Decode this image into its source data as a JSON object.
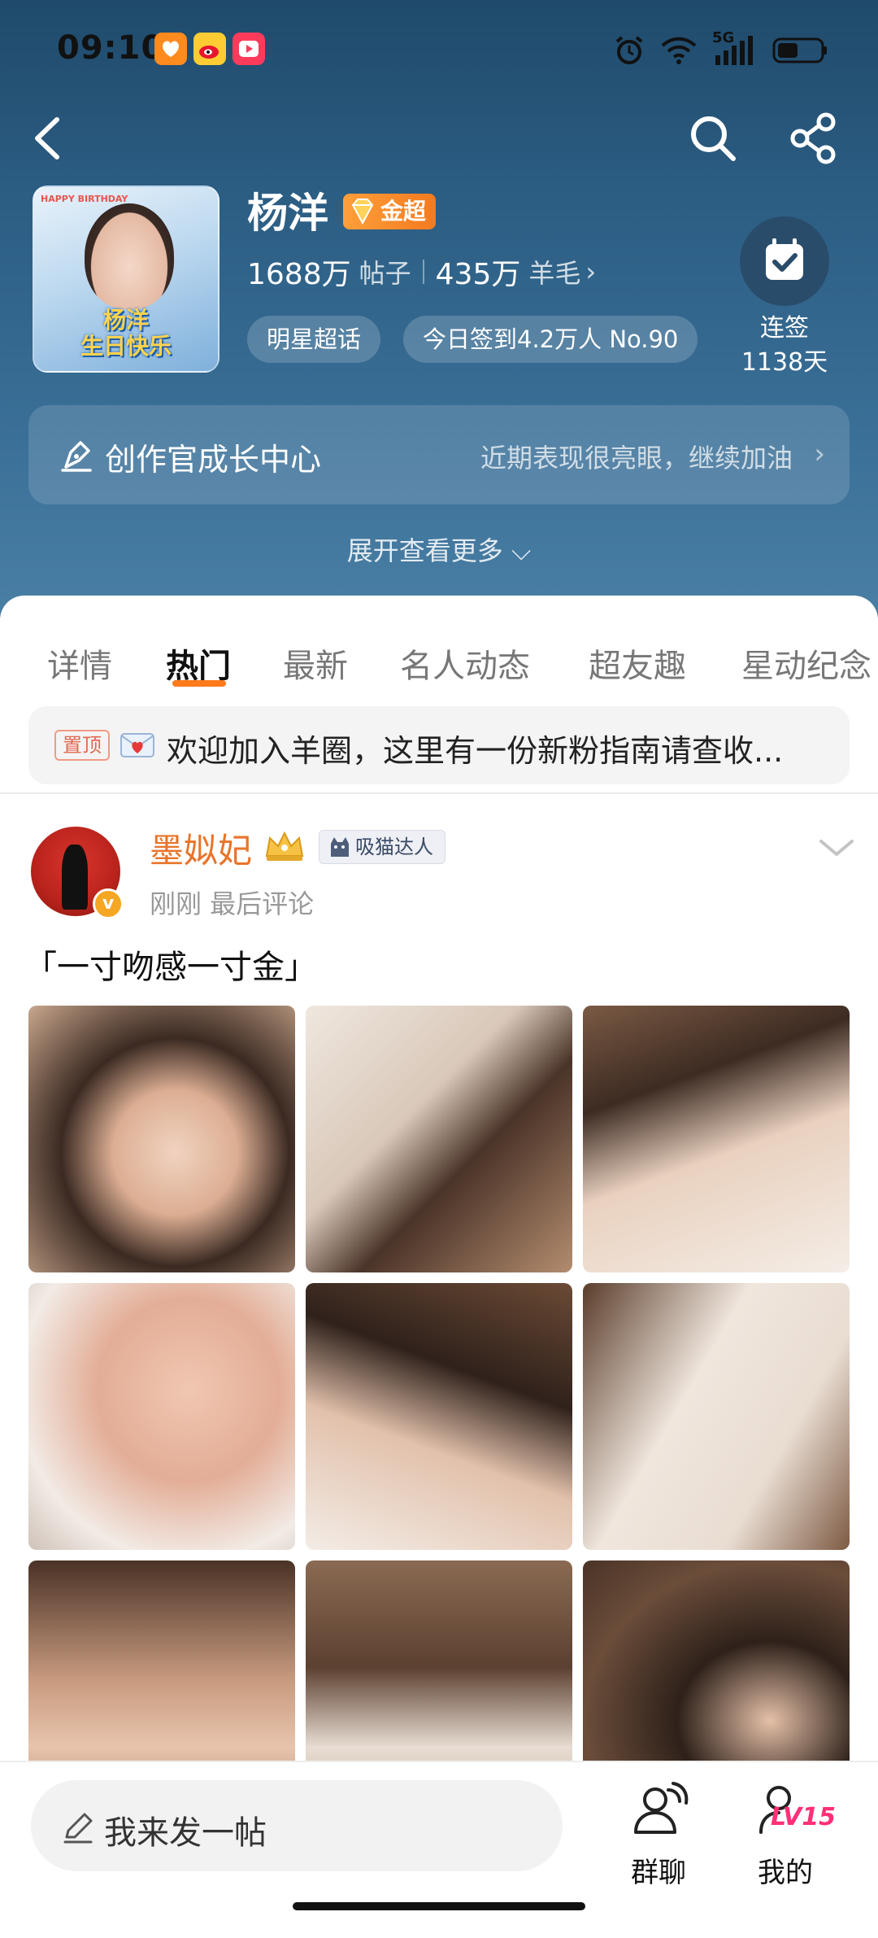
{
  "status_bar": {
    "time": "09:10",
    "network": "5G",
    "apps": [
      "taobao-icon",
      "weibo-icon",
      "video-icon"
    ],
    "system_icons": [
      "alarm-icon",
      "wifi-icon",
      "signal-icon",
      "battery-icon"
    ]
  },
  "header": {
    "back_icon": "chevron-left-icon",
    "search_icon": "search-icon",
    "share_icon": "share-icon"
  },
  "topic": {
    "name": "杨洋",
    "badge_label": "金超",
    "avatar_text": "杨洋\n生日快乐",
    "avatar_tag": "HAPPY BIRTHDAY",
    "posts_count": "1688万",
    "posts_unit": "帖子",
    "fans_count": "435万",
    "fans_unit": "羊毛",
    "fans_chevron": "›",
    "category_pill": "明星超话",
    "checkin_pill": "今日签到4.2万人 No.90",
    "streak_label": "连签",
    "streak_days": "1138天"
  },
  "creator_center": {
    "title": "创作官成长中心",
    "subtitle": "近期表现很亮眼，继续加油",
    "chevron": "›"
  },
  "expand_label": "展开查看更多 ⌵",
  "tabs": [
    {
      "label": "详情",
      "active": false
    },
    {
      "label": "热门",
      "active": true
    },
    {
      "label": "最新",
      "active": false
    },
    {
      "label": "名人动态",
      "active": false
    },
    {
      "label": "超友趣",
      "active": false
    },
    {
      "label": "星动纪念",
      "active": false
    }
  ],
  "pinned": {
    "tag": "置顶",
    "text": "欢迎加入羊圈，这里有一份新粉指南请查收..."
  },
  "post": {
    "author": "墨姒妃",
    "badge": "吸猫达人",
    "meta": "刚刚 最后评论",
    "text": "「一寸吻感一寸金」",
    "photo_count": 9
  },
  "bottom_bar": {
    "compose_placeholder": "我来发一帖",
    "group_label": "群聊",
    "me_label": "我的",
    "level": "LV15"
  },
  "colors": {
    "accent": "#ff7a1a",
    "header_top": "#1f4a6b",
    "header_bottom": "#4a7fa5",
    "author_name": "#e8742a",
    "level": "#ff2f78"
  }
}
